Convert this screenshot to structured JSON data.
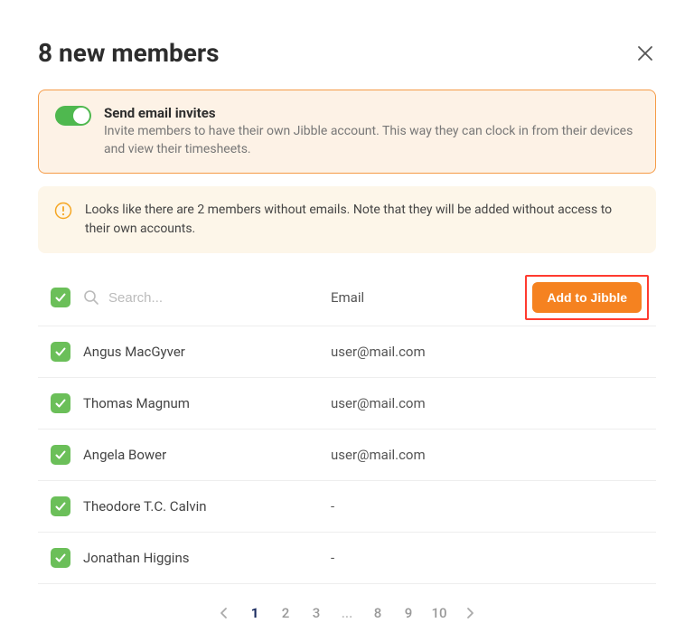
{
  "header": {
    "title": "8 new members"
  },
  "invite": {
    "title": "Send email invites",
    "desc": "Invite members to have their own Jibble account. This way they can clock in from their devices and view their timesheets."
  },
  "warning": {
    "text": "Looks like there are 2 members without emails. Note that they will be added without access to their own accounts."
  },
  "table": {
    "search_placeholder": "Search...",
    "email_header": "Email",
    "add_button": "Add to Jibble"
  },
  "rows": [
    {
      "name": "Angus MacGyver",
      "email": "user@mail.com"
    },
    {
      "name": "Thomas Magnum",
      "email": "user@mail.com"
    },
    {
      "name": "Angela Bower",
      "email": "user@mail.com"
    },
    {
      "name": "Theodore T.C. Calvin",
      "email": "-"
    },
    {
      "name": "Jonathan Higgins",
      "email": "-"
    }
  ],
  "pagination": {
    "pages": [
      "1",
      "2",
      "3",
      "...",
      "8",
      "9",
      "10"
    ],
    "active": "1"
  }
}
